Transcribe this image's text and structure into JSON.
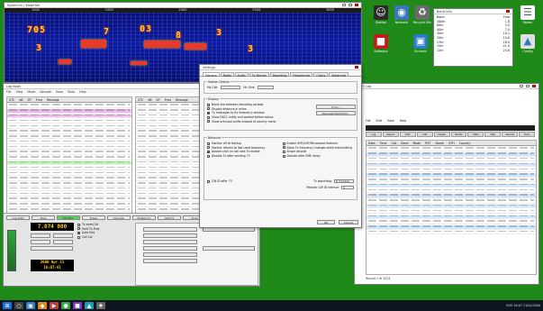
{
  "waterfall": {
    "title": "Spectrum / Waterfall",
    "scale": [
      "1000",
      "1500",
      "2000",
      "2500",
      "3000"
    ],
    "signals": [
      "705",
      "7",
      "03",
      "8",
      "3",
      "3",
      "3"
    ]
  },
  "desktop_icons": [
    {
      "name": "user-icon",
      "label": "Station",
      "glyph": "☺",
      "bg": "#2b2b2b"
    },
    {
      "name": "network-icon",
      "label": "Network",
      "glyph": "◉",
      "bg": "#3a76b8"
    },
    {
      "name": "recycle-icon",
      "label": "Recycle Bin",
      "glyph": "♻",
      "bg": "#6a6a6a"
    },
    {
      "name": "document-icon",
      "label": "Notes",
      "glyph": "☰",
      "bg": "#ffffff"
    },
    {
      "name": "app-red-icon",
      "label": "Software",
      "glyph": "■",
      "bg": "#c21b1b"
    },
    {
      "name": "image-icon",
      "label": "Screens",
      "glyph": "▣",
      "bg": "#2a7bc5"
    },
    {
      "name": "lock-icon",
      "label": "Config",
      "glyph": "▲",
      "bg": "#e0e0e0"
    }
  ],
  "infowin": {
    "title": "Band Info",
    "rows": [
      [
        "Band",
        "Freq"
      ],
      [
        "160m",
        "1.8"
      ],
      [
        "80m",
        "3.5"
      ],
      [
        "40m",
        "7.0"
      ],
      [
        "30m",
        "10.1"
      ],
      [
        "20m",
        "14.0"
      ],
      [
        "17m",
        "18.0"
      ],
      [
        "15m",
        "21.0"
      ],
      [
        "12m",
        "24.8"
      ]
    ]
  },
  "logwin": {
    "title": "Log Book",
    "menu": [
      "File",
      "View",
      "Mode",
      "Decode",
      "Save",
      "Tools",
      "Help"
    ],
    "left_header": [
      "UTC",
      "dB",
      "DT",
      "Freq",
      "Message"
    ],
    "right_header": [
      "UTC",
      "dB",
      "DT",
      "Freq",
      "Message"
    ],
    "left_rows": [
      "",
      "pink",
      "pink",
      "",
      "",
      "",
      "",
      "",
      "",
      "",
      "",
      "green",
      "",
      "",
      "",
      "",
      "",
      "",
      "",
      "",
      "",
      "",
      "",
      "",
      "",
      "",
      "",
      "",
      "",
      "",
      ""
    ],
    "right_rows": [
      "",
      "",
      "",
      "",
      "",
      "",
      "",
      "",
      "",
      "",
      "",
      "",
      "",
      "",
      "",
      "",
      "",
      "",
      "",
      "",
      "",
      "",
      "",
      "",
      "",
      "",
      "",
      "",
      "",
      "",
      ""
    ],
    "frequency": "7.074 000",
    "datetime": "2000 Apr 21",
    "time": "16:07:41",
    "buttons": [
      "Log QSO",
      "Stop",
      "Monitor",
      "Erase",
      "Decode",
      "Enable Tx",
      "Halt Tx",
      "Tune"
    ],
    "controls": [
      "Tx even/1st",
      "Hold Tx Freq",
      "Auto Seq",
      "Call 1st"
    ]
  },
  "settings": {
    "title": "Settings",
    "tabs": [
      "General",
      "Radio",
      "Audio",
      "Tx Macros",
      "Reporting",
      "Frequencies",
      "Colors",
      "Advanced"
    ],
    "station_label": "Station Details",
    "call_label": "My Call:",
    "call_value": "",
    "grid_label": "My Grid:",
    "grid_value": "",
    "display_label": "Display",
    "display_options": [
      "Blank line between decoding periods",
      "Display distance in miles",
      "Tx messages to Rx frequency window",
      "Show DXCC entity and worked before status",
      "Show principal prefix instead of country name"
    ],
    "display_states": [
      false,
      false,
      true,
      false,
      false
    ],
    "font_button": "Font...",
    "decoded_font_button": "Decoded Text Font...",
    "behavior_label": "Behavior",
    "behavior_left": [
      "Monitor off at startup",
      "Monitor returns to last used frequency",
      "Double-click on call sets Tx enable",
      "Disable Tx after sending 73"
    ],
    "behavior_right": [
      "Enable VHF/UHF/Microwave features",
      "Allow Tx frequency changes while transmitting",
      "Single decode",
      "Decode after EME delay"
    ],
    "behavior_states_left": [
      false,
      false,
      true,
      false
    ],
    "behavior_states_right": [
      false,
      false,
      false,
      false
    ],
    "cw_label": "CW ID after 73",
    "tx_watchdog_label": "Tx watchdog:",
    "tx_watchdog_value": "6 minutes",
    "periodic_cw_label": "Periodic CW ID Interval:",
    "periodic_cw_value": "0",
    "ok": "OK",
    "cancel": "Cancel"
  },
  "rightlog": {
    "title": "QSO Log",
    "menu": [
      "File",
      "Edit",
      "View",
      "Help"
    ],
    "tabs": [
      "Log",
      "Search",
      "Edit",
      "Add",
      "Cluster",
      "Bands",
      "Stats",
      "Map",
      "Awards",
      "Tools"
    ],
    "columns": [
      "Date",
      "Time",
      "Call",
      "Band",
      "Mode",
      "RST",
      "Name",
      "QTH",
      "Country"
    ],
    "rows": 17,
    "status": "Record 1 of 1024"
  },
  "taskbar": {
    "apps": [
      "⊞",
      "○",
      "▣",
      "◆",
      "▶",
      "●",
      "■",
      "▲",
      "❖"
    ],
    "tray": "ENG  16:07  21/04/2000"
  },
  "colors": {
    "desktop": "#1f8a1a",
    "waterfall": "#0b0f5c",
    "signal": "#ffd21a",
    "log_pink": "#f3b7ef",
    "log_green": "#b8f5b0"
  }
}
